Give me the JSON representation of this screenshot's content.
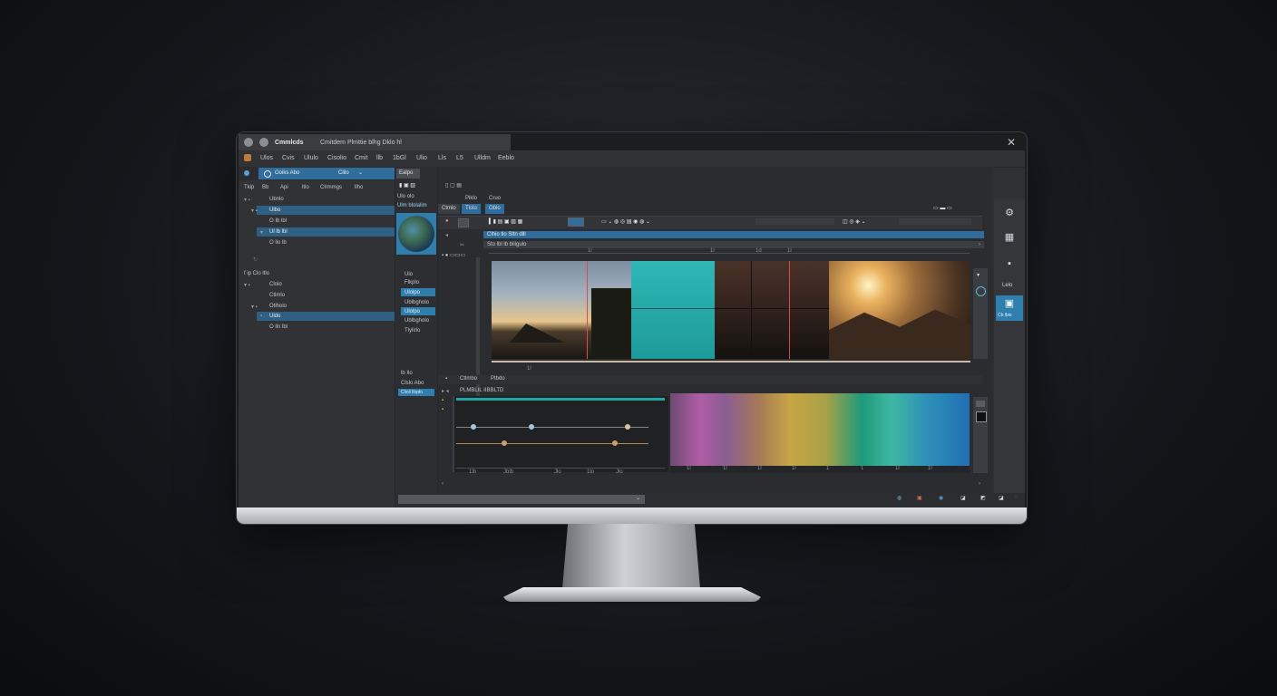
{
  "window": {
    "title": "Cmmlcds",
    "title_menu": "Cmitdem  Plmttie  blhg  Dklo  hl"
  },
  "menubar": [
    "Ulos",
    "Cvis",
    "Ululo",
    "Cisolio",
    "Cmit",
    "llb",
    "1bGl",
    "Ulio",
    "Lls",
    "L5",
    "Ulldm",
    "Eeblo"
  ],
  "left_panel": {
    "search_label": "Ooiks Abo",
    "search_dropdown": "Clilo",
    "filter_labels": [
      "Tkip",
      "Bb",
      "Api",
      "ltlo",
      "Clrmmgs",
      "llho"
    ],
    "tree_a": [
      {
        "label": "Ubnlo",
        "selected": false
      },
      {
        "label": "Ulbo",
        "selected": true
      },
      {
        "label": "O Ib lbl",
        "selected": false
      },
      {
        "label": "Ul lb lbl",
        "selected": true
      },
      {
        "label": "O llo lb",
        "selected": false
      }
    ],
    "tree_b_header": "f ip Clo ltlo",
    "tree_b": [
      {
        "label": "Clolo",
        "selected": false
      },
      {
        "label": "Ctlmlo",
        "selected": false
      },
      {
        "label": "Otlholo",
        "selected": false
      },
      {
        "label": "Uldo",
        "selected": true
      },
      {
        "label": "O lln lbl",
        "selected": false
      }
    ]
  },
  "mid_panel": {
    "tab": "Ealpo",
    "header": "Ulo olo",
    "header2": "Ulm blolalim",
    "list_head": "Ulo",
    "items": [
      {
        "label": "Flkplo",
        "selected": false
      },
      {
        "label": "Ulolpo",
        "selected": true
      },
      {
        "label": "Ublbgholo",
        "selected": false
      },
      {
        "label": "Ulolpo",
        "selected": true
      },
      {
        "label": "Ublbgholo",
        "selected": false
      },
      {
        "label": "Tlylirlo",
        "selected": false
      }
    ],
    "lower_head": "lb Ilo",
    "lower_item": "Clslo Abo",
    "lower_sel": "Clioli lloplo"
  },
  "editor": {
    "tabs_top": [
      "Plklo",
      "Cruo"
    ],
    "tabs": [
      "Ctmlo",
      "Tlsto",
      "Oblo"
    ],
    "track_label": "Clhio tlo Sltn dlll",
    "track_label2": "Sto lbl lb blilgulo",
    "ruler_labels": [
      "1l",
      "1l",
      "1d",
      "1l"
    ],
    "bottom_tabs": [
      "Ctlmbo",
      "Ptbdo"
    ],
    "graph_label": "PLMBLIL IIBBLTD",
    "graph_ticks": [
      "1lb",
      "Jblb",
      "Jlo",
      "1lo",
      "Jlo"
    ],
    "wave_ticks": [
      "1l",
      "1l",
      "1l",
      "1l",
      "1",
      "1",
      "1l",
      "1l",
      "1l",
      "1l"
    ],
    "row_labels": [
      "Ctalio",
      "Cloo"
    ]
  },
  "right_bar": {
    "label": "Lelo",
    "selected_label": "Cb lbio"
  },
  "colors": {
    "accent": "#2f6e9c",
    "selected": "#2f5f83",
    "teal": "#1fb3b0"
  }
}
